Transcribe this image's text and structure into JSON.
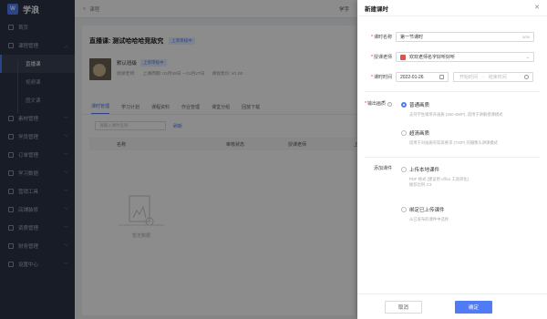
{
  "app": {
    "title": "学浪",
    "logo_icon": "logo-icon"
  },
  "sidebar": {
    "items": [
      {
        "label": "首页",
        "icon": "home-icon"
      },
      {
        "label": "课程管理",
        "icon": "course-icon",
        "expanded": true
      },
      {
        "label": "直播课",
        "sub": true,
        "active": true
      },
      {
        "label": "视频课",
        "sub": true
      },
      {
        "label": "图文课",
        "sub": true
      },
      {
        "label": "素材管理",
        "icon": "material-icon"
      },
      {
        "label": "学员管理",
        "icon": "student-icon"
      },
      {
        "label": "订单管理",
        "icon": "order-icon"
      },
      {
        "label": "学习数据",
        "icon": "data-icon"
      },
      {
        "label": "营销工具",
        "icon": "marketing-icon"
      },
      {
        "label": "店铺装修",
        "icon": "decorate-icon"
      },
      {
        "label": "资质管理",
        "icon": "qualification-icon"
      },
      {
        "label": "财务管理",
        "icon": "finance-icon"
      },
      {
        "label": "设置中心",
        "icon": "settings-icon"
      }
    ]
  },
  "topbar": {
    "back": "<",
    "breadcrumb": "课程",
    "right_link": "学字"
  },
  "main": {
    "page_title": "直播课: 测试哈哈哈竞敌究",
    "status_tag": "上架审核中",
    "course": {
      "name": "默认班级",
      "tag": "上架审核中",
      "teacher_label": "授课老师:",
      "period": "上课周期: 01月28日 ~ 01月27日",
      "price": "课程售价: ¥1.00"
    },
    "tabs": [
      "课时管理",
      "学习计划",
      "课程资料",
      "作业管理",
      "课堂分组",
      "回放下载"
    ],
    "search_placeholder": "请输入课时名称",
    "refresh": "刷新",
    "table_headers": [
      "名称",
      "审核状态",
      "授课老师",
      "上"
    ],
    "empty_text": "暂无数据"
  },
  "drawer": {
    "title": "新建课时",
    "close_icon": "close-icon",
    "fields": {
      "name_label": "课时名称",
      "name_value": "第一节课时",
      "name_count": "5/30",
      "teacher_label": "授课老师",
      "teacher_value": "欢欢老师名字好听好听",
      "time_label": "课时时间",
      "date_value": "2022-01-26",
      "start_placeholder": "开始时间",
      "sep": "-",
      "end_placeholder": "结束时间"
    },
    "quality": {
      "label": "输出画质",
      "options": [
        {
          "title": "普通画质",
          "desc": "支持学生端单开画质 (360-480P), 适用于讲解授课模式",
          "checked": true
        },
        {
          "title": "超清画质",
          "desc": "适用于对画质有较高要求 (720P) 的摄像头讲课模式",
          "checked": false
        }
      ]
    },
    "courseware": {
      "label": "添加课件",
      "options": [
        {
          "title": "上传本地课件",
          "desc": "PDF 格式 (建议用 office 工具转化)\n推荐比例 4:3",
          "checked": false
        },
        {
          "title": "绑定已上传课件",
          "desc": "从已发布的课件中选择",
          "checked": false
        }
      ]
    },
    "cancel": "取消",
    "ok": "确定"
  },
  "colors": {
    "primary": "#4f7cf6",
    "sidebar_bg": "#2d3446",
    "required": "#f5222d"
  }
}
